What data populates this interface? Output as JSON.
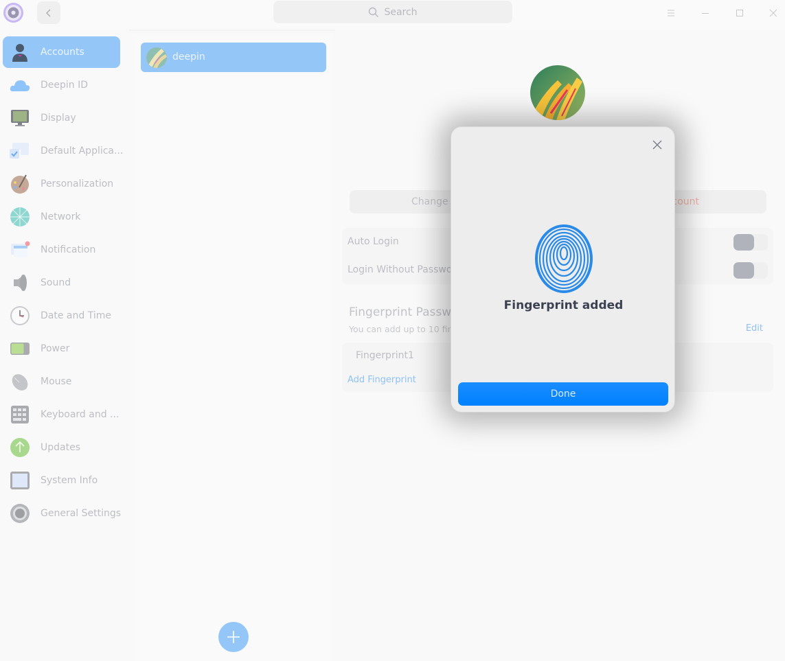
{
  "titlebar": {
    "app_icon": "control-center-gear-icon",
    "back_icon": "chevron-left-icon",
    "search": {
      "placeholder": "Search",
      "value": ""
    },
    "controls": [
      "menu-icon",
      "minimize-icon",
      "maximize-icon",
      "close-icon"
    ]
  },
  "sidebar": {
    "items": [
      {
        "label": "Accounts",
        "icon": "user-accounts-icon",
        "active": true
      },
      {
        "label": "Deepin ID",
        "icon": "cloud-icon",
        "active": false
      },
      {
        "label": "Display",
        "icon": "monitor-icon",
        "active": false
      },
      {
        "label": "Default Applica...",
        "icon": "default-apps-icon",
        "active": false
      },
      {
        "label": "Personalization",
        "icon": "palette-icon",
        "active": false
      },
      {
        "label": "Network",
        "icon": "network-globe-icon",
        "active": false
      },
      {
        "label": "Notification",
        "icon": "notification-icon",
        "active": false
      },
      {
        "label": "Sound",
        "icon": "speaker-icon",
        "active": false
      },
      {
        "label": "Date and Time",
        "icon": "clock-icon",
        "active": false
      },
      {
        "label": "Power",
        "icon": "battery-icon",
        "active": false
      },
      {
        "label": "Mouse",
        "icon": "mouse-icon",
        "active": false
      },
      {
        "label": "Keyboard and ...",
        "icon": "keyboard-icon",
        "active": false
      },
      {
        "label": "Updates",
        "icon": "update-arrow-icon",
        "active": false
      },
      {
        "label": "System Info",
        "icon": "system-info-icon",
        "active": false
      },
      {
        "label": "General Settings",
        "icon": "gear-icon",
        "active": false
      }
    ]
  },
  "accounts": {
    "list": [
      {
        "name": "deepin",
        "selected": true
      }
    ],
    "add_button_icon": "plus-icon"
  },
  "detail": {
    "change_password_label": "Change",
    "delete_account_label": "count",
    "settings": [
      {
        "label": "Auto Login",
        "enabled": false
      },
      {
        "label": "Login Without Passwor",
        "enabled": false
      }
    ],
    "fingerprint": {
      "title": "Fingerprint Passw",
      "subtitle": "You can add up to 10 fin",
      "edit_label": "Edit",
      "items": [
        "Fingerprint1"
      ],
      "add_label": "Add Fingerprint"
    }
  },
  "modal": {
    "icon": "fingerprint-icon",
    "title": "Fingerprint added",
    "done_label": "Done",
    "close_icon": "close-icon"
  },
  "colors": {
    "accent": "#0081ff",
    "selection": "#95c6f8",
    "fingerprint": "#2a8ae8",
    "danger": "#f0b0a5"
  }
}
